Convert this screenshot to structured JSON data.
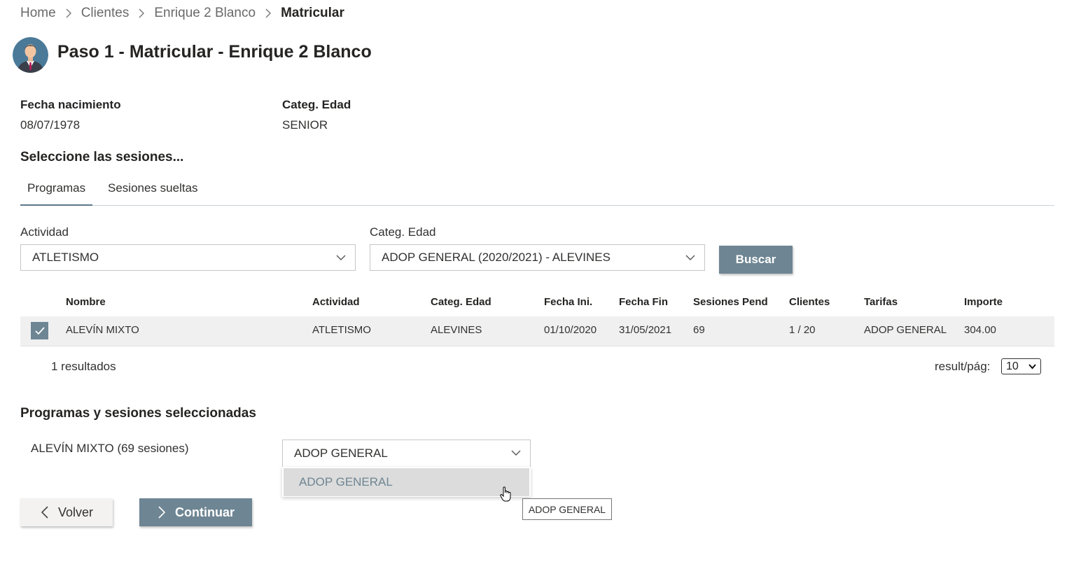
{
  "breadcrumb": {
    "items": [
      "Home",
      "Clientes",
      "Enrique 2 Blanco"
    ],
    "current": "Matricular"
  },
  "header": {
    "title": "Paso 1 - Matricular - Enrique 2 Blanco"
  },
  "info": {
    "birth_label": "Fecha nacimiento",
    "birth_value": "08/07/1978",
    "age_label": "Categ. Edad",
    "age_value": "SENIOR"
  },
  "sessions_heading": "Seleccione las sesiones...",
  "tabs": [
    {
      "label": "Programas",
      "active": true
    },
    {
      "label": "Sesiones sueltas",
      "active": false
    }
  ],
  "filters": {
    "activity_label": "Actividad",
    "activity_value": "ATLETISMO",
    "category_label": "Categ. Edad",
    "category_value": "ADOP GENERAL (2020/2021) - ALEVINES",
    "search_button": "Buscar"
  },
  "table": {
    "headers": [
      "Nombre",
      "Actividad",
      "Categ. Edad",
      "Fecha Ini.",
      "Fecha Fin",
      "Sesiones Pend",
      "Clientes",
      "Tarifas",
      "Importe"
    ],
    "rows": [
      {
        "checked": true,
        "cells": [
          "ALEVÍN MIXTO",
          "ATLETISMO",
          "ALEVINES",
          "01/10/2020",
          "31/05/2021",
          "69",
          "1 / 20",
          "ADOP GENERAL",
          "304.00"
        ]
      }
    ],
    "results_text": "1 resultados",
    "per_page_label": "result/pág:",
    "per_page_value": "10"
  },
  "selected": {
    "heading": "Programas y sesiones seleccionadas",
    "program_label": "ALEVÍN MIXTO (69 sesiones)",
    "rate_value": "ADOP GENERAL",
    "rate_options": [
      "ADOP GENERAL"
    ]
  },
  "actions": {
    "back": "Volver",
    "continue": "Continuar"
  },
  "tooltip": "ADOP GENERAL",
  "colors": {
    "accent": "#6e8593",
    "row_bg": "#f0f0f0",
    "option_bg": "#dcdcdc"
  }
}
